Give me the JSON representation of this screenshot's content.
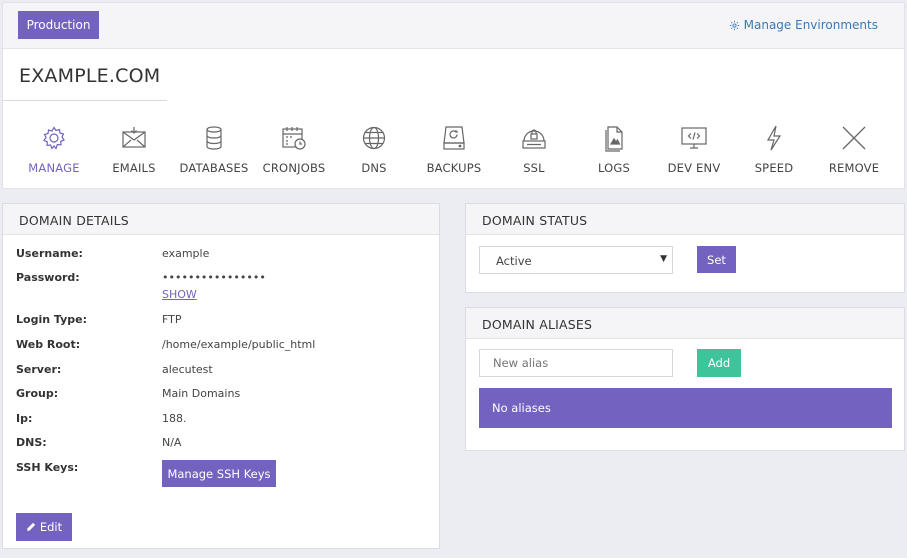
{
  "header": {
    "environment_button": "Production",
    "manage_environments_link": "Manage Environments",
    "domain_title": "EXAMPLE.COM"
  },
  "toolbar": {
    "items": [
      {
        "label": "MANAGE",
        "icon": "gear-icon",
        "active": true
      },
      {
        "label": "EMAILS",
        "icon": "envelope-icon",
        "active": false
      },
      {
        "label": "DATABASES",
        "icon": "database-icon",
        "active": false
      },
      {
        "label": "CRONJOBS",
        "icon": "calendar-clock-icon",
        "active": false
      },
      {
        "label": "DNS",
        "icon": "globe-icon",
        "active": false
      },
      {
        "label": "BACKUPS",
        "icon": "hard-drive-restore-icon",
        "active": false
      },
      {
        "label": "SSL",
        "icon": "lock-drive-icon",
        "active": false
      },
      {
        "label": "LOGS",
        "icon": "document-icon",
        "active": false
      },
      {
        "label": "DEV ENV",
        "icon": "code-monitor-icon",
        "active": false
      },
      {
        "label": "SPEED",
        "icon": "lightning-icon",
        "active": false
      },
      {
        "label": "REMOVE",
        "icon": "x-icon",
        "active": false
      }
    ],
    "accent_color": "#7462c0"
  },
  "domain_details": {
    "title": "DOMAIN DETAILS",
    "fields": [
      {
        "label": "Username:",
        "value": "example"
      },
      {
        "label": "Password:",
        "value": "••••••••••••••••"
      },
      {
        "label": "Login Type:",
        "value": "FTP"
      },
      {
        "label": "Web Root:",
        "value": "/home/example/public_html"
      },
      {
        "label": "Server:",
        "value": "alecutest"
      },
      {
        "label": "Group:",
        "value": "Main Domains"
      },
      {
        "label": "Ip:",
        "value": "188."
      },
      {
        "label": "DNS:",
        "value": "N/A"
      },
      {
        "label": "SSH Keys:",
        "value": ""
      }
    ],
    "show_link": "SHOW",
    "ssh_button": "Manage SSH Keys",
    "edit_button": "Edit"
  },
  "domain_status": {
    "title": "DOMAIN STATUS",
    "selected": "Active",
    "set_button": "Set"
  },
  "domain_aliases": {
    "title": "DOMAIN ALIASES",
    "input_placeholder": "New alias",
    "add_button": "Add",
    "empty_message": "No aliases",
    "add_color": "#3ec39a"
  }
}
